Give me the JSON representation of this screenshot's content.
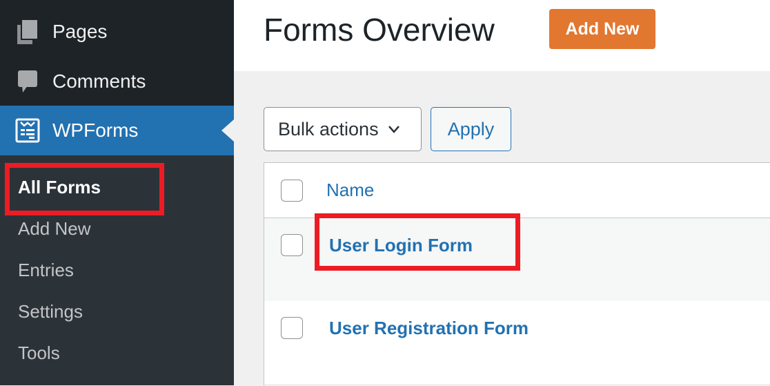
{
  "sidebar": {
    "menu": [
      {
        "label": "Pages",
        "icon": "pages-icon"
      },
      {
        "label": "Comments",
        "icon": "comment-icon"
      },
      {
        "label": "WPForms",
        "icon": "wpforms-icon",
        "active": true
      }
    ],
    "submenu": [
      {
        "label": "All Forms",
        "current": true
      },
      {
        "label": "Add New"
      },
      {
        "label": "Entries"
      },
      {
        "label": "Settings"
      },
      {
        "label": "Tools"
      }
    ]
  },
  "header": {
    "title": "Forms Overview",
    "add_new_label": "Add New"
  },
  "toolbar": {
    "bulk_actions_label": "Bulk actions",
    "apply_label": "Apply"
  },
  "table": {
    "columns": [
      "Name"
    ],
    "rows": [
      {
        "name": "User Login Form"
      },
      {
        "name": "User Registration Form"
      }
    ]
  },
  "colors": {
    "accent": "#2271b1",
    "add_new": "#e27730",
    "highlight": "#ed1c24",
    "sidebar": "#1d2327"
  }
}
